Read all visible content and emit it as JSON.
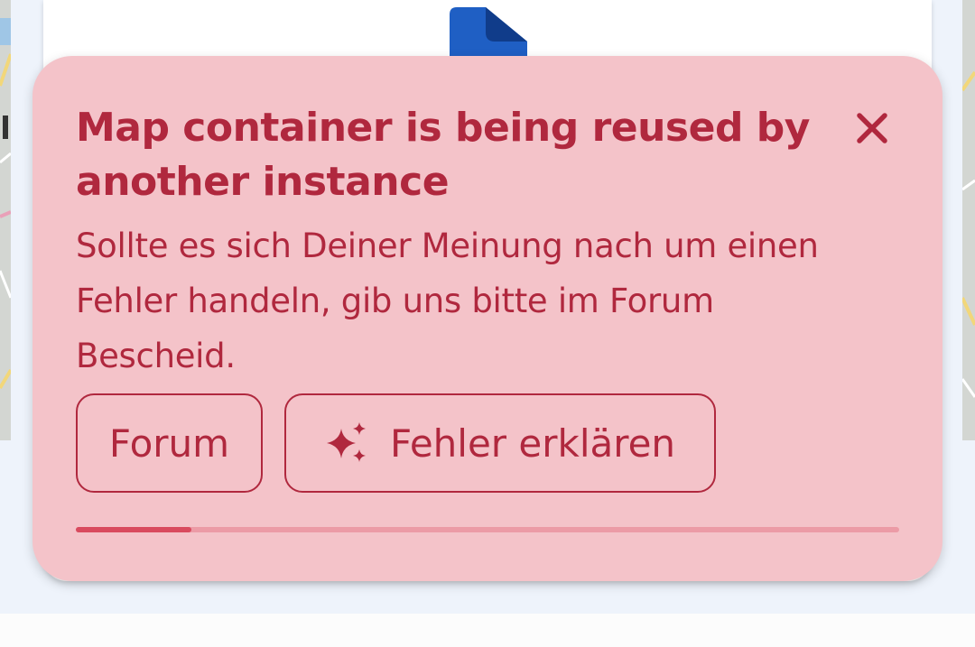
{
  "toast": {
    "title": "Map container is being reused by another instance",
    "body": "Sollte es sich Deiner Meinung nach um einen Fehler handeln, gib uns bitte im Forum Bescheid.",
    "forum_button": "Forum",
    "explain_button": "Fehler erklären",
    "explain_icon": "sparkle-icon",
    "close_icon": "close-icon",
    "progress": 0.14
  },
  "background": {
    "card_icon": "document-icon"
  },
  "colors": {
    "toast_bg": "#f4c3c9",
    "toast_text": "#b0283e",
    "progress_track": "#ec9ba6",
    "progress_fill": "#d94a5e",
    "doc_icon": "#1f5fc4"
  }
}
